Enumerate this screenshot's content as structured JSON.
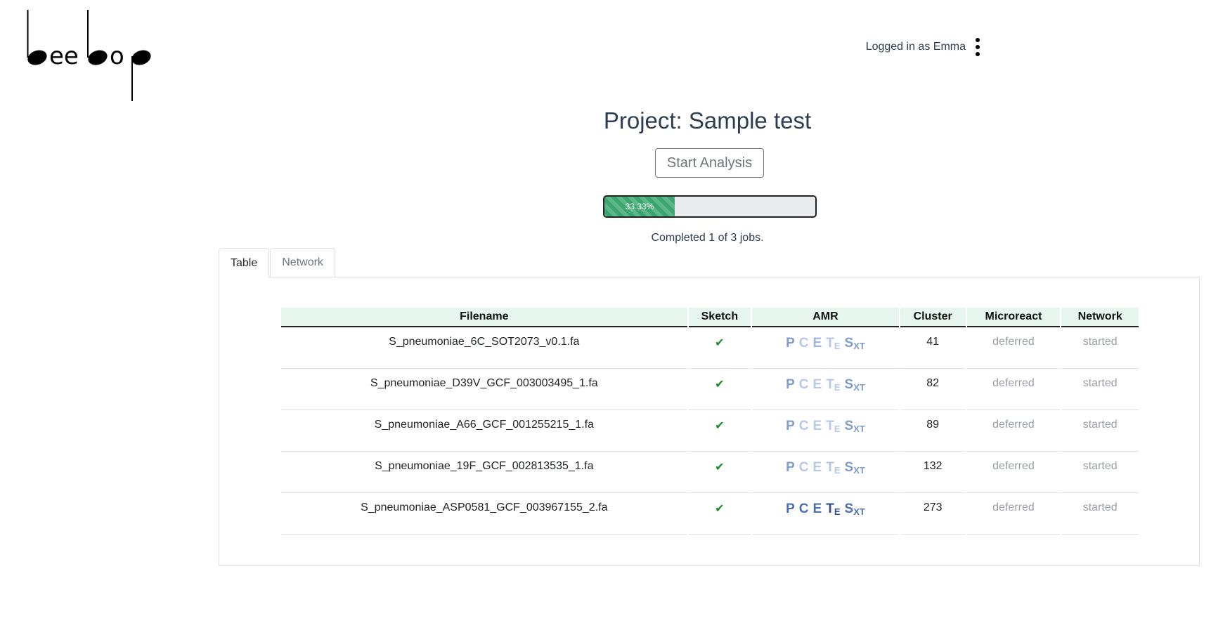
{
  "brand": {
    "logo_text": "beebop"
  },
  "header": {
    "user_label": "Logged in as Emma"
  },
  "project": {
    "title": "Project: Sample test",
    "start_button": "Start Analysis"
  },
  "progress": {
    "percent": 33.33,
    "label": "33.33%",
    "caption": "Completed 1 of 3 jobs."
  },
  "tabs": [
    {
      "label": "Table",
      "active": true
    },
    {
      "label": "Network",
      "active": false
    }
  ],
  "table": {
    "columns": [
      "Filename",
      "Sketch",
      "AMR",
      "Cluster",
      "Microreact",
      "Network"
    ],
    "rows": [
      {
        "filename": "S_pneumoniae_6C_SOT2073_v0.1.fa",
        "sketch": "✔",
        "amr": [
          "P",
          "C",
          "E",
          "T",
          "E",
          "S",
          "XT"
        ],
        "amr_colors": [
          "#7f9ccf",
          "#b6c9ea",
          "#9fb5df",
          "#b6c9ea",
          "#b6c9ea",
          "#7f9ccf",
          "#7f9ccf"
        ],
        "cluster": "41",
        "microreact": "deferred",
        "network": "started"
      },
      {
        "filename": "S_pneumoniae_D39V_GCF_003003495_1.fa",
        "sketch": "✔",
        "amr": [
          "P",
          "C",
          "E",
          "T",
          "E",
          "S",
          "XT"
        ],
        "amr_colors": [
          "#7f9ccf",
          "#b6c9ea",
          "#b6c9ea",
          "#b6c9ea",
          "#b6c9ea",
          "#7f9ccf",
          "#7f9ccf"
        ],
        "cluster": "82",
        "microreact": "deferred",
        "network": "started"
      },
      {
        "filename": "S_pneumoniae_A66_GCF_001255215_1.fa",
        "sketch": "✔",
        "amr": [
          "P",
          "C",
          "E",
          "T",
          "E",
          "S",
          "XT"
        ],
        "amr_colors": [
          "#7f9ccf",
          "#b6c9ea",
          "#b6c9ea",
          "#b6c9ea",
          "#b6c9ea",
          "#7f9ccf",
          "#7f9ccf"
        ],
        "cluster": "89",
        "microreact": "deferred",
        "network": "started"
      },
      {
        "filename": "S_pneumoniae_19F_GCF_002813535_1.fa",
        "sketch": "✔",
        "amr": [
          "P",
          "C",
          "E",
          "T",
          "E",
          "S",
          "XT"
        ],
        "amr_colors": [
          "#7f9ccf",
          "#b6c9ea",
          "#b6c9ea",
          "#b6c9ea",
          "#b6c9ea",
          "#7f9ccf",
          "#7f9ccf"
        ],
        "cluster": "132",
        "microreact": "deferred",
        "network": "started"
      },
      {
        "filename": "S_pneumoniae_ASP0581_GCF_003967155_2.fa",
        "sketch": "✔",
        "amr": [
          "P",
          "C",
          "E",
          "T",
          "E",
          "S",
          "XT"
        ],
        "amr_colors": [
          "#4a6fb5",
          "#4a6fb5",
          "#4a6fb5",
          "#2f4f95",
          "#2f4f95",
          "#4a6fb5",
          "#4a6fb5"
        ],
        "cluster": "273",
        "microreact": "deferred",
        "network": "started"
      }
    ]
  },
  "colors": {
    "progress_fill": "#3aa56f",
    "header_row": "#e6f5ee",
    "check": "#1a8a2a",
    "muted": "#9aa0a6"
  }
}
